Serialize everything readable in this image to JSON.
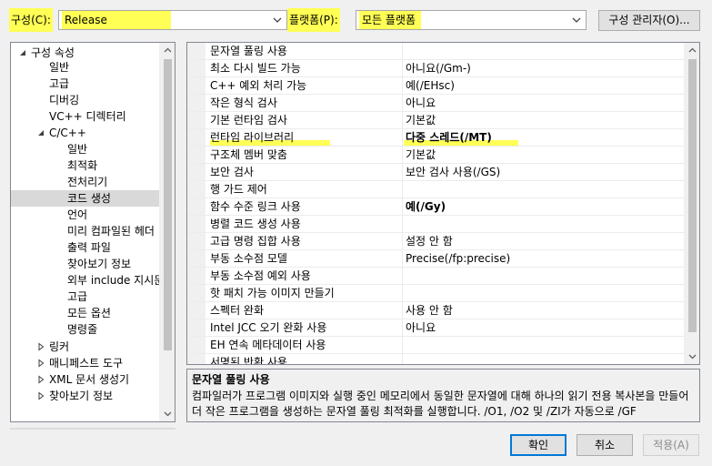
{
  "topbar": {
    "config_label": "구성(C):",
    "config_value": "Release",
    "platform_label": "플랫폼(P):",
    "platform_value": "모든 플랫폼",
    "config_manager_label": "구성 관리자(O)..."
  },
  "tree": {
    "items": [
      {
        "label": "구성 속성"
      },
      {
        "label": "일반"
      },
      {
        "label": "고급"
      },
      {
        "label": "디버깅"
      },
      {
        "label": "VC++ 디렉터리"
      },
      {
        "label": "C/C++"
      },
      {
        "label": "일반"
      },
      {
        "label": "최적화"
      },
      {
        "label": "전처리기"
      },
      {
        "label": "코드 생성"
      },
      {
        "label": "언어"
      },
      {
        "label": "미리 컴파일된 헤더"
      },
      {
        "label": "출력 파일"
      },
      {
        "label": "찾아보기 정보"
      },
      {
        "label": "외부 include 지시문"
      },
      {
        "label": "고급"
      },
      {
        "label": "모든 옵션"
      },
      {
        "label": "명령줄"
      },
      {
        "label": "링커"
      },
      {
        "label": "매니페스트 도구"
      },
      {
        "label": "XML 문서 생성기"
      },
      {
        "label": "찾아보기 정보"
      }
    ]
  },
  "grid": {
    "rows": [
      {
        "name": "문자열 풀링 사용",
        "value": ""
      },
      {
        "name": "최소 다시 빌드 가능",
        "value": "아니요(/Gm-)"
      },
      {
        "name": "C++ 예외 처리 가능",
        "value": "예(/EHsc)"
      },
      {
        "name": "작은 형식 검사",
        "value": "아니요"
      },
      {
        "name": "기본 런타임 검사",
        "value": "기본값"
      },
      {
        "name": "런타임 라이브러리",
        "value": "다중 스레드(/MT)"
      },
      {
        "name": "구조체 멤버 맞춤",
        "value": "기본값"
      },
      {
        "name": "보안 검사",
        "value": "보안 검사 사용(/GS)"
      },
      {
        "name": "행 가드 제어",
        "value": ""
      },
      {
        "name": "함수 수준 링크 사용",
        "value": "예(/Gy)"
      },
      {
        "name": "병렬 코드 생성 사용",
        "value": ""
      },
      {
        "name": "고급 명령 집합 사용",
        "value": "설정 안 함"
      },
      {
        "name": "부동 소수점 모델",
        "value": "Precise(/fp:precise)"
      },
      {
        "name": "부동 소수점 예외 사용",
        "value": ""
      },
      {
        "name": "핫 패치 가능 이미지 만들기",
        "value": ""
      },
      {
        "name": "스펙터 완화",
        "value": "사용 안 함"
      },
      {
        "name": "Intel JCC 오기 완화 사용",
        "value": "아니요"
      },
      {
        "name": "EH 연속 메타데이터 사용",
        "value": ""
      },
      {
        "name": "서명된 반환 사용",
        "value": ""
      }
    ]
  },
  "description": {
    "title": "문자열 풀링 사용",
    "text": "컴파일러가 프로그램 이미지와 실행 중인 메모리에서 동일한 문자열에 대해 하나의 읽기 전용 복사본을 만들어 더 작은 프로그램을 생성하는 문자열 풀링 최적화를 실행합니다. /O1, /O2 및 /ZI가 자동으로 /GF"
  },
  "buttons": {
    "ok": "확인",
    "cancel": "취소",
    "apply": "적용(A)"
  },
  "colors": {
    "highlight": "#ffff55",
    "accent": "#0078d7",
    "selected_tree_item": "#d9d9d9"
  }
}
